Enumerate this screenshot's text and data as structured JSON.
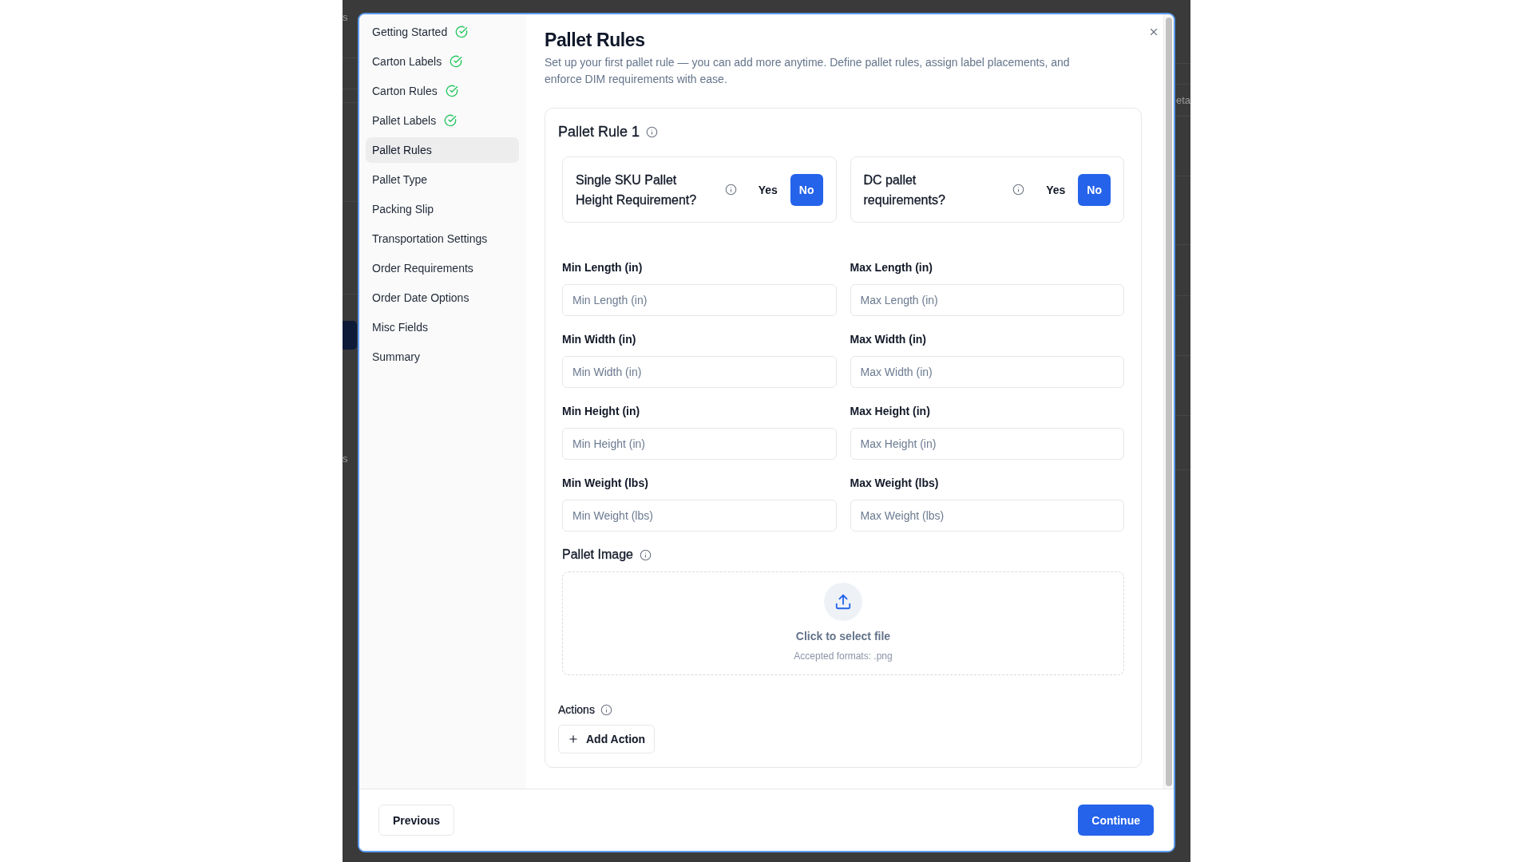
{
  "backdrop": {
    "left_texts": [
      "s",
      "s"
    ],
    "right_texts": [
      "eta"
    ]
  },
  "sidebar": {
    "items": [
      {
        "label": "Getting Started",
        "completed": true,
        "selected": false
      },
      {
        "label": "Carton Labels",
        "completed": true,
        "selected": false
      },
      {
        "label": "Carton Rules",
        "completed": true,
        "selected": false
      },
      {
        "label": "Pallet Labels",
        "completed": true,
        "selected": false
      },
      {
        "label": "Pallet Rules",
        "completed": false,
        "selected": true
      },
      {
        "label": "Pallet Type",
        "completed": false,
        "selected": false
      },
      {
        "label": "Packing Slip",
        "completed": false,
        "selected": false
      },
      {
        "label": "Transportation Settings",
        "completed": false,
        "selected": false
      },
      {
        "label": "Order Requirements",
        "completed": false,
        "selected": false
      },
      {
        "label": "Order Date Options",
        "completed": false,
        "selected": false
      },
      {
        "label": "Misc Fields",
        "completed": false,
        "selected": false
      },
      {
        "label": "Summary",
        "completed": false,
        "selected": false
      }
    ]
  },
  "header": {
    "title": "Pallet Rules",
    "description": "Set up your first pallet rule — you can add more anytime. Define pallet rules, assign label placements, and enforce DIM requirements with ease."
  },
  "rule": {
    "title": "Pallet Rule 1",
    "toggles": [
      {
        "question": "Single SKU Pallet Height Requirement?",
        "options": [
          {
            "label": "Yes",
            "selected": false
          },
          {
            "label": "No",
            "selected": true
          }
        ]
      },
      {
        "question": "DC pallet requirements?",
        "options": [
          {
            "label": "Yes",
            "selected": false
          },
          {
            "label": "No",
            "selected": true
          }
        ]
      }
    ],
    "fields": [
      {
        "label": "Min Length (in)",
        "placeholder": "Min Length (in)"
      },
      {
        "label": "Max Length (in)",
        "placeholder": "Max Length (in)"
      },
      {
        "label": "Min Width (in)",
        "placeholder": "Min Width (in)"
      },
      {
        "label": "Max Width (in)",
        "placeholder": "Max Width (in)"
      },
      {
        "label": "Min Height (in)",
        "placeholder": "Min Height (in)"
      },
      {
        "label": "Max Height (in)",
        "placeholder": "Max Height (in)"
      },
      {
        "label": "Min Weight (lbs)",
        "placeholder": "Min Weight (lbs)"
      },
      {
        "label": "Max Weight (lbs)",
        "placeholder": "Max Weight (lbs)"
      }
    ],
    "image": {
      "label": "Pallet Image",
      "prompt": "Click to select file",
      "hint": "Accepted formats: .png"
    },
    "actions": {
      "label": "Actions",
      "button": "Add Action"
    }
  },
  "footer": {
    "buttons": [
      {
        "label": "Previous",
        "kind": "secondary"
      },
      {
        "label": "Continue",
        "kind": "primary"
      }
    ]
  }
}
